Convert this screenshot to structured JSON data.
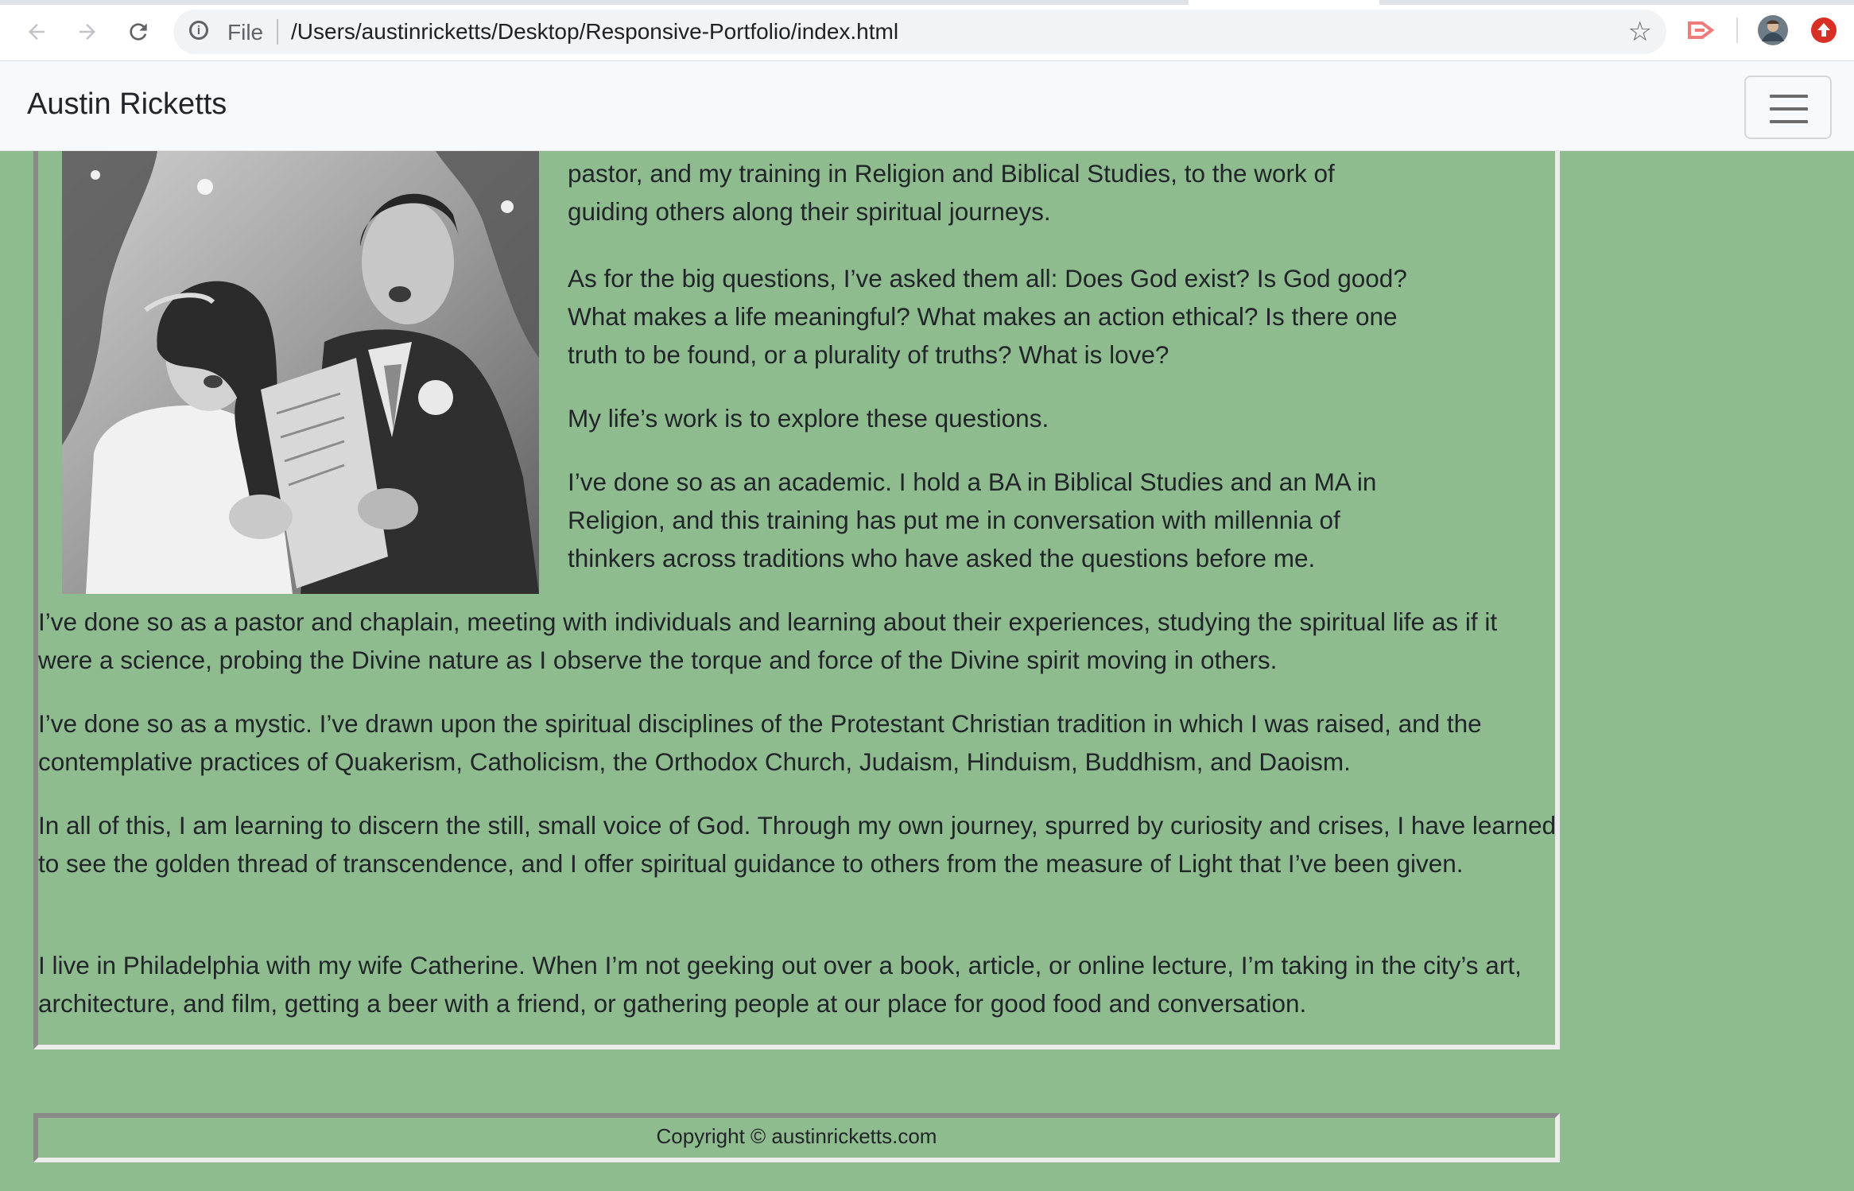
{
  "browser": {
    "file_label": "File",
    "url": "/Users/austinricketts/Desktop/Responsive-Portfolio/index.html",
    "back_icon": "arrow-left-icon",
    "forward_icon": "arrow-right-icon",
    "reload_icon": "reload-icon",
    "info_icon": "info-icon",
    "bookmark_icon": "star-icon"
  },
  "navbar": {
    "brand": "Austin Ricketts",
    "toggler_icon": "hamburger-menu-icon"
  },
  "about": {
    "photo_alt": "Black and white wedding photo of a couple singing from a program",
    "paragraphs_beside_photo": [
      "pastor, and my training in Religion and Biblical Studies, to the work of guiding others along their spiritual journeys.",
      "As for the big questions, I’ve asked them all: Does God exist? Is God good? What makes a life meaningful? What makes an action ethical? Is there one truth to be found, or a plurality of truths? What is love?",
      "My life’s work is to explore these questions.",
      "I’ve done so as an academic. I hold a BA in Biblical Studies and an MA in Religion, and this training has put me in conversation with millennia of thinkers across traditions who have asked the questions before me."
    ],
    "paragraphs_full": [
      "I’ve done so as a pastor and chaplain, meeting with individuals and learning about their experiences, studying the spiritual life as if it were a science, probing the Divine nature as I observe the torque and force of the Divine spirit moving in others.",
      "I’ve done so as a mystic. I’ve drawn upon the spiritual disciplines of the Protestant Christian tradition in which I was raised, and the contemplative practices of Quakerism, Catholicism, the Orthodox Church, Judaism, Hinduism, Buddhism, and Daoism.",
      "In all of this, I am learning to discern the still, small voice of God. Through my own journey, spurred by curiosity and crises, I have learned to see the golden thread of transcendence, and I offer spiritual guidance to others from the measure of Light that I’ve been given.",
      "I live in Philadelphia with my wife Catherine. When I’m not geeking out over a book, article, or online lecture, I’m taking in the city’s art, architecture, and film, getting a beer with a friend, or gathering people at our place for good food and conversation."
    ]
  },
  "footer": {
    "copyright": "Copyright © austinricketts.com"
  },
  "colors": {
    "page_background": "#8fbc8f",
    "navbar_background": "#f8f9fa"
  }
}
